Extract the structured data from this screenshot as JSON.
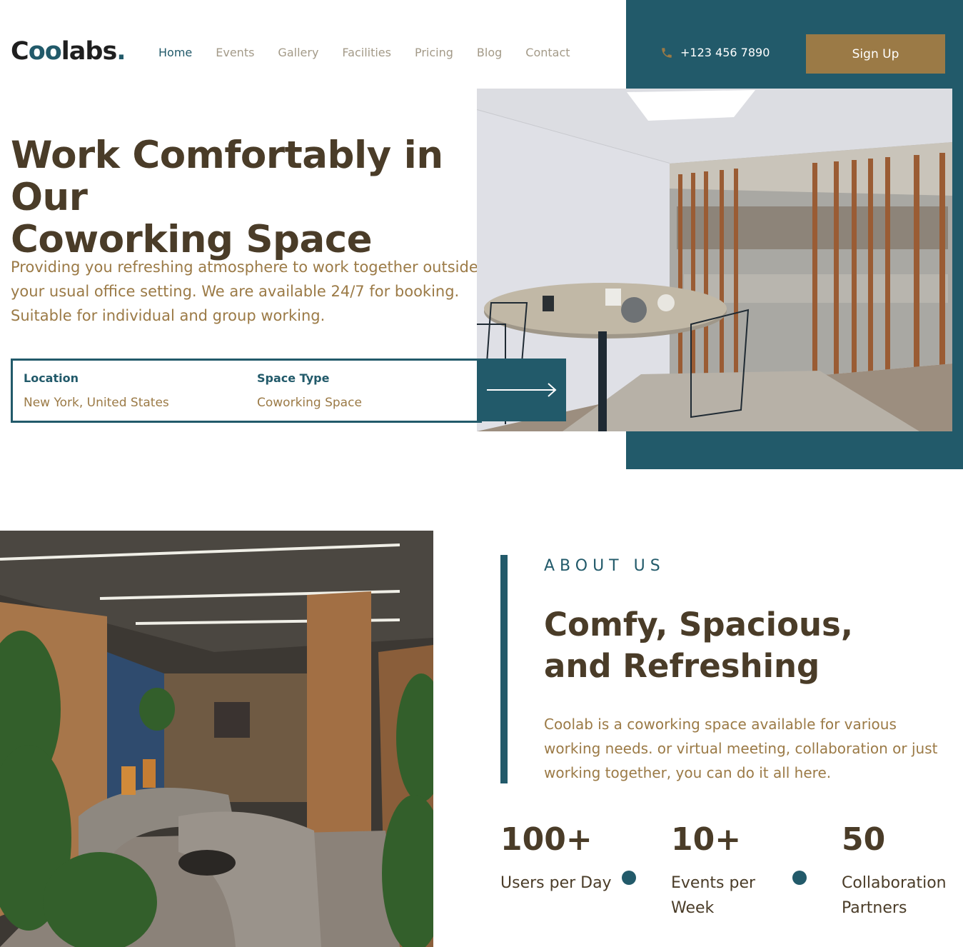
{
  "brand": {
    "logo_prefix": "C",
    "logo_oo": "oo",
    "logo_rest": "labs",
    "logo_dot": "."
  },
  "nav": {
    "items": [
      "Home",
      "Events",
      "Gallery",
      "Facilities",
      "Pricing",
      "Blog",
      "Contact"
    ],
    "active": "Home"
  },
  "header": {
    "phone": "+123 456 7890",
    "signup_label": "Sign Up",
    "phone_icon": "phone-icon"
  },
  "hero": {
    "title_line1": "Work Comfortably in Our",
    "title_line2": "Coworking Space",
    "description": "Providing you refreshing atmosphere to work together outside your usual office setting. We are available 24/7 for booking. Suitable for individual and group working.",
    "search": {
      "location_label": "Location",
      "location_value": "New York, United States",
      "space_type_label": "Space Type",
      "space_type_value": "Coworking Space",
      "submit_icon": "arrow-right-icon"
    }
  },
  "about": {
    "eyebrow": "ABOUT US",
    "title_line1": "Comfy, Spacious,",
    "title_line2": "and Refreshing",
    "description": "Coolab is a coworking space available for various working needs. or virtual meeting, collaboration or just working together, you can do it all here.",
    "stats": [
      {
        "value": "100+",
        "label": "Users per Day"
      },
      {
        "value": "10+",
        "label": "Events per Week"
      },
      {
        "value": "50",
        "label": "Collaboration Partners"
      }
    ]
  },
  "colors": {
    "teal": "#225a6a",
    "gold": "#9b7a46",
    "brown": "#4a3c28",
    "muted": "#a39a88"
  }
}
